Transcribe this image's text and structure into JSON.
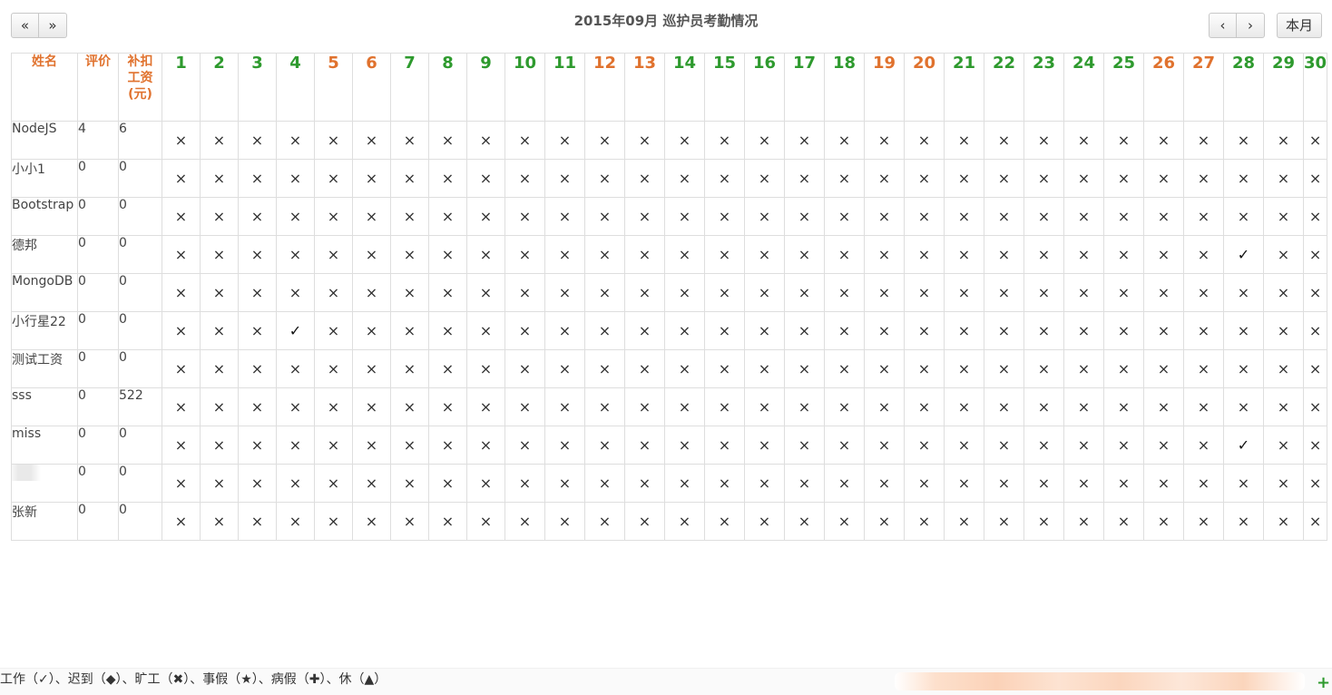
{
  "nav": {
    "prev_year": "«",
    "next_year": "»",
    "prev_month": "‹",
    "next_month": "›",
    "current_month": "本月"
  },
  "title": "2015年09月 巡护员考勤情况",
  "columns": {
    "name": "姓名",
    "rating": "评价",
    "bonus_line1": "补扣",
    "bonus_line2": "工资",
    "bonus_line3": "(元)"
  },
  "days": [
    {
      "label": "1",
      "type": "work"
    },
    {
      "label": "2",
      "type": "work"
    },
    {
      "label": "3",
      "type": "work"
    },
    {
      "label": "4",
      "type": "work"
    },
    {
      "label": "5",
      "type": "rest"
    },
    {
      "label": "6",
      "type": "rest"
    },
    {
      "label": "7",
      "type": "work"
    },
    {
      "label": "8",
      "type": "work"
    },
    {
      "label": "9",
      "type": "work"
    },
    {
      "label": "10",
      "type": "work"
    },
    {
      "label": "11",
      "type": "work"
    },
    {
      "label": "12",
      "type": "rest"
    },
    {
      "label": "13",
      "type": "rest"
    },
    {
      "label": "14",
      "type": "work"
    },
    {
      "label": "15",
      "type": "work"
    },
    {
      "label": "16",
      "type": "work"
    },
    {
      "label": "17",
      "type": "work"
    },
    {
      "label": "18",
      "type": "work"
    },
    {
      "label": "19",
      "type": "rest"
    },
    {
      "label": "20",
      "type": "rest"
    },
    {
      "label": "21",
      "type": "work"
    },
    {
      "label": "22",
      "type": "work"
    },
    {
      "label": "23",
      "type": "work"
    },
    {
      "label": "24",
      "type": "work"
    },
    {
      "label": "25",
      "type": "work"
    },
    {
      "label": "26",
      "type": "rest"
    },
    {
      "label": "27",
      "type": "rest"
    },
    {
      "label": "28",
      "type": "work"
    },
    {
      "label": "29",
      "type": "work"
    },
    {
      "label": "30",
      "type": "work"
    }
  ],
  "symbols": {
    "absent": "×",
    "present": "✓"
  },
  "rows": [
    {
      "name": "NodeJS",
      "rating": "4",
      "bonus": "6",
      "present_days": []
    },
    {
      "name": "小小1",
      "rating": "0",
      "bonus": "0",
      "present_days": []
    },
    {
      "name": "Bootstrap",
      "rating": "0",
      "bonus": "0",
      "present_days": []
    },
    {
      "name": "德邦",
      "rating": "0",
      "bonus": "0",
      "present_days": [
        28
      ]
    },
    {
      "name": "MongoDB",
      "rating": "0",
      "bonus": "0",
      "present_days": []
    },
    {
      "name": "小行星22",
      "rating": "0",
      "bonus": "0",
      "present_days": [
        4
      ]
    },
    {
      "name": "测试工资",
      "rating": "0",
      "bonus": "0",
      "present_days": []
    },
    {
      "name": "sss",
      "rating": "0",
      "bonus": "522",
      "present_days": []
    },
    {
      "name": "miss",
      "rating": "0",
      "bonus": "0",
      "present_days": [
        28
      ]
    },
    {
      "name": "",
      "rating": "0",
      "bonus": "0",
      "present_days": []
    },
    {
      "name": "张新",
      "rating": "0",
      "bonus": "0",
      "present_days": []
    }
  ],
  "legend": "工作（✓）、迟到（◆）、旷工（✖）、事假（★）、病假（✚）、休（▲）",
  "colors": {
    "work_day": "#2e9a2e",
    "rest_day": "#e0722e",
    "header_meta": "#e0722e"
  }
}
